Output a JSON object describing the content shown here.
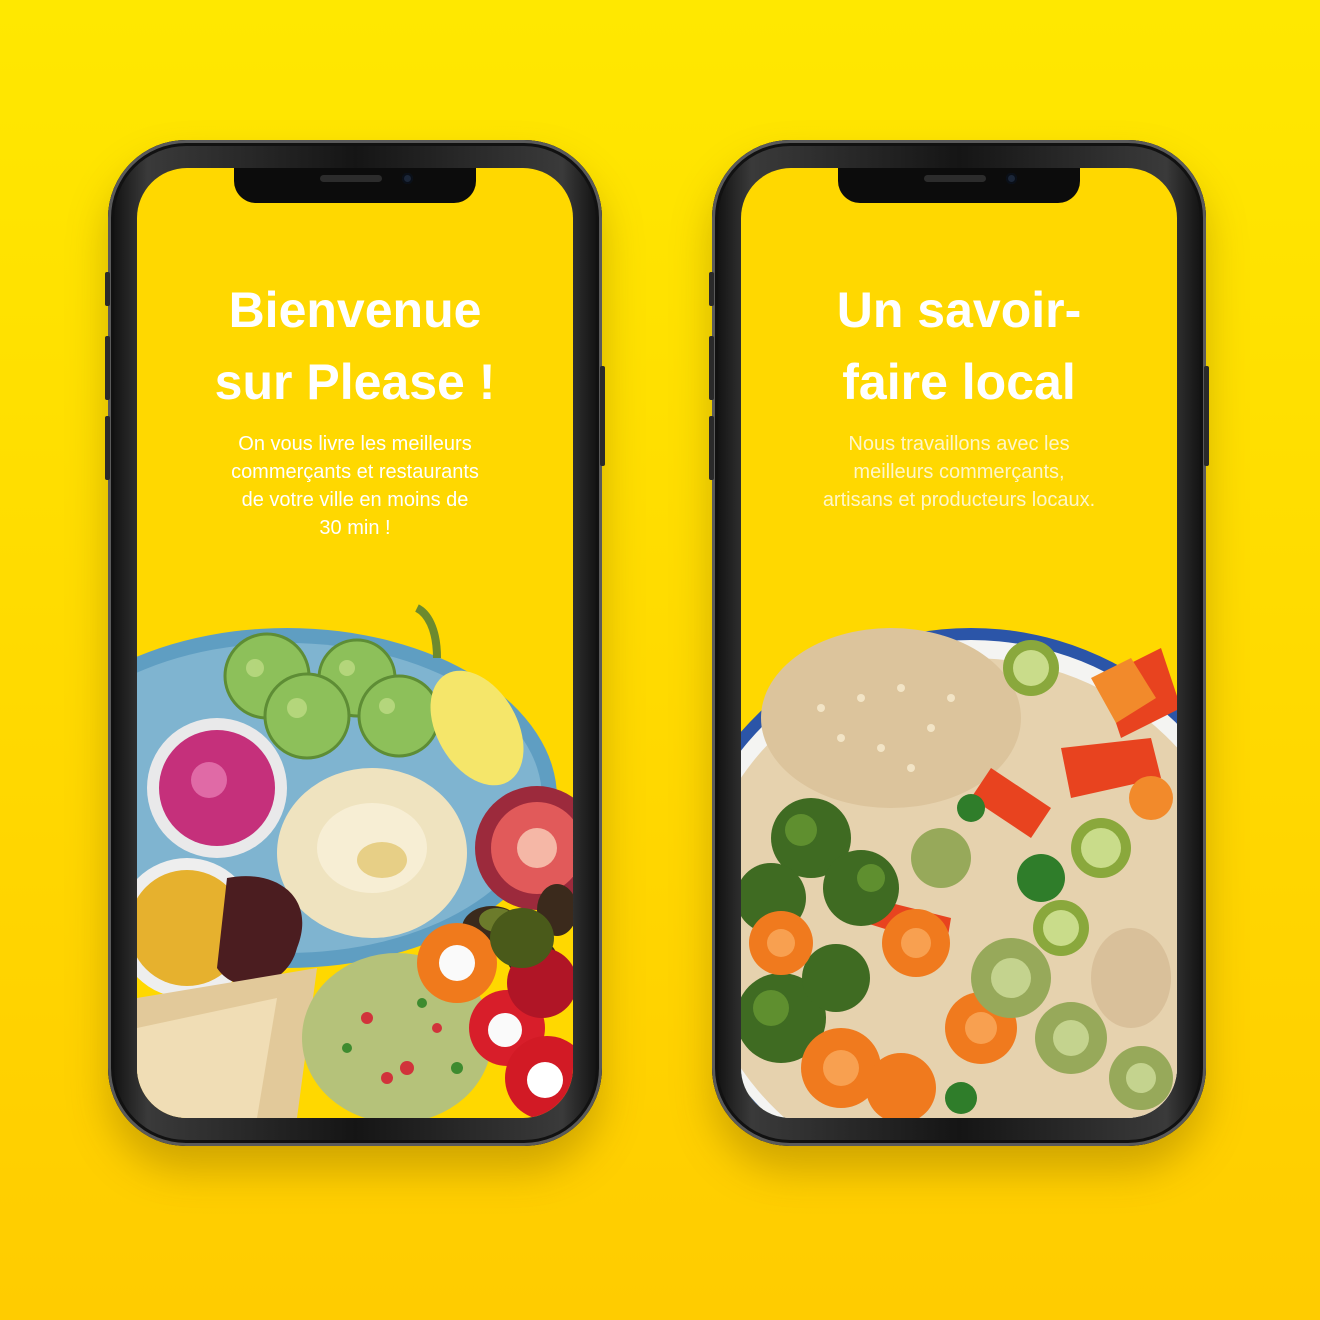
{
  "screens": [
    {
      "title_line1": "Bienvenue",
      "title_line2": "sur Please !",
      "subtitle_lines": [
        "On vous livre les meilleurs",
        "commerçants et restaurants",
        "de votre ville en moins de",
        "30 min !"
      ]
    },
    {
      "title_line1": "Un savoir-",
      "title_line2": "faire local",
      "subtitle_lines": [
        "Nous travaillons avec les",
        "meilleurs commerçants,",
        "artisans et producteurs locaux."
      ]
    }
  ],
  "colors": {
    "background": "#FFE000",
    "screen": "#FFD800",
    "text": "#FFFFFF"
  }
}
